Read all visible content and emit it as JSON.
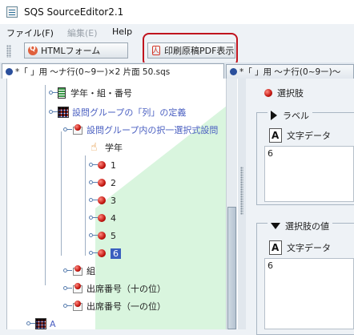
{
  "window": {
    "title": "SQS SourceEditor2.1"
  },
  "menubar": [
    {
      "label": "ファイル(F)",
      "enabled": true
    },
    {
      "label": "編集(E)",
      "enabled": false
    },
    {
      "label": "Help",
      "enabled": true
    }
  ],
  "toolbar": {
    "html_button": "HTMLフォーム",
    "pdf_button": "印刷原稿PDF表示"
  },
  "tabs": [
    {
      "label": "*「 」用 ～ナ行(0~9ー)×2 片面 50.sqs",
      "active": true
    },
    {
      "label": "*「 」用 ～ナ行(0~9ー)～",
      "active": false
    }
  ],
  "tree": {
    "rows": [
      {
        "label": "学年・組・番号",
        "icon": "bar-icon"
      },
      {
        "label": "設問グループの「列」の定義",
        "icon": "grid-icon"
      },
      {
        "label": "設問グループ内の択一選択式設問",
        "icon": "folder-ball-icon"
      },
      {
        "label": "学年",
        "icon": "hand-cursor-icon"
      },
      {
        "label": "1",
        "icon": "red-ball-icon"
      },
      {
        "label": "2",
        "icon": "red-ball-icon"
      },
      {
        "label": "3",
        "icon": "red-ball-icon"
      },
      {
        "label": "4",
        "icon": "red-ball-icon"
      },
      {
        "label": "5",
        "icon": "red-ball-icon"
      },
      {
        "label": "6",
        "icon": "red-ball-icon",
        "selected": true
      },
      {
        "label": "組",
        "icon": "folder-ball-icon"
      },
      {
        "label": "出席番号（十の位）",
        "icon": "folder-ball-icon"
      },
      {
        "label": "出席番号（一の位）",
        "icon": "folder-ball-icon"
      },
      {
        "label": "A",
        "icon": "grid-icon"
      }
    ]
  },
  "detail": {
    "header": "選択肢",
    "label_section": "ラベル",
    "label_data_type": "文字データ",
    "label_value": "6",
    "value_section": "選択肢の値",
    "value_data_type": "文字データ",
    "value_value": "6"
  }
}
